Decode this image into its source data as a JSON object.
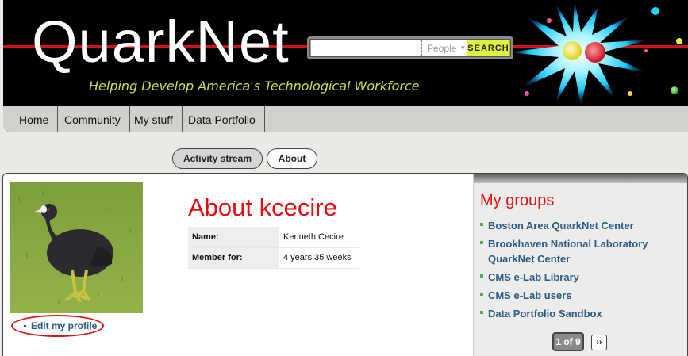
{
  "header": {
    "logo_text": "QuarkNet",
    "tagline": "Helping Develop America's Technological Workforce"
  },
  "search": {
    "value": "",
    "type_label": "People",
    "button_label": "SEARCH"
  },
  "nav": {
    "items": [
      {
        "label": "Home"
      },
      {
        "label": "Community"
      },
      {
        "label": "My stuff"
      },
      {
        "label": "Data Portfolio"
      }
    ]
  },
  "tabs": {
    "activity": "Activity stream",
    "about": "About",
    "active": "About"
  },
  "profile": {
    "title": "About kcecire",
    "fields": [
      {
        "label": "Name:",
        "value": "Kenneth Cecire"
      },
      {
        "label": "Member for:",
        "value": "4 years 35 weeks"
      }
    ],
    "edit_link": "Edit my profile"
  },
  "groups": {
    "title": "My groups",
    "items": [
      "Boston Area QuarkNet Center",
      "Brookhaven National Laboratory QuarkNet Center",
      "CMS e-Lab Library",
      "CMS e-Lab users",
      "Data Portfolio Sandbox"
    ],
    "pager_current": "1 of 9",
    "pager_next": "››"
  },
  "colors": {
    "accent_red": "#e40c12",
    "link_blue": "#2a5b86",
    "search_button": "#dff23f",
    "tagline": "#c8e04a"
  }
}
